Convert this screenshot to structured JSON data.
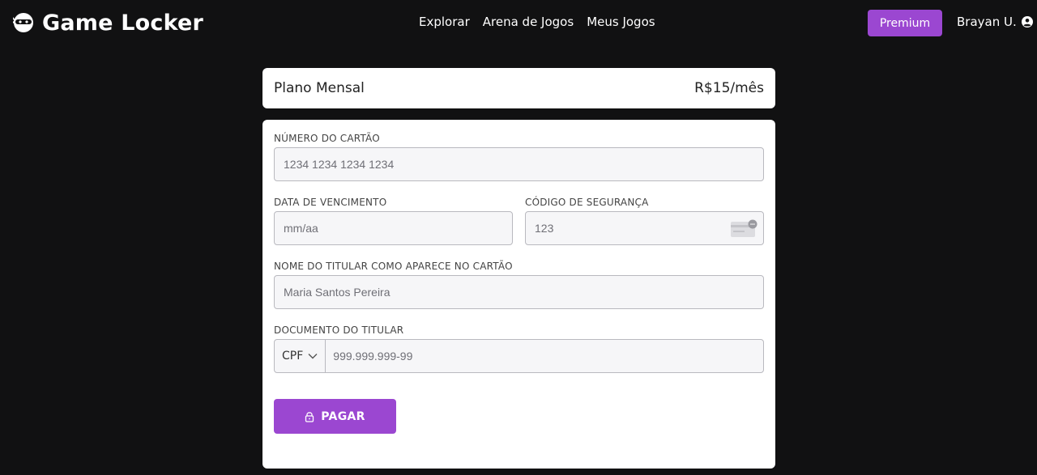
{
  "header": {
    "brand": "Game Locker",
    "nav": [
      "Explorar",
      "Arena de Jogos",
      "Meus Jogos"
    ],
    "premium_label": "Premium",
    "user_name": "Brayan U."
  },
  "plan": {
    "name": "Plano Mensal",
    "price": "R$15/mês"
  },
  "form": {
    "card_number": {
      "label": "NÚMERO DO CARTÃO",
      "placeholder": "1234 1234 1234 1234",
      "value": ""
    },
    "expiry": {
      "label": "DATA DE VENCIMENTO",
      "placeholder": "mm/aa",
      "value": ""
    },
    "cvv": {
      "label": "CÓDIGO DE SEGURANÇA",
      "placeholder": "123",
      "value": ""
    },
    "holder_name": {
      "label": "NOME DO TITULAR COMO APARECE NO CARTÃO",
      "placeholder": "Maria Santos Pereira",
      "value": ""
    },
    "document": {
      "label": "DOCUMENTO DO TITULAR",
      "type_selected": "CPF",
      "placeholder": "999.999.999-99",
      "value": ""
    },
    "pay_label": "PAGAR"
  },
  "colors": {
    "background": "#111112",
    "accent": "#9b47d1",
    "card": "#ffffff",
    "field_bg": "#f6f6f8"
  },
  "icons": {
    "logo": "ninja-mask-icon",
    "user": "user-circle-icon",
    "cvv": "credit-card-icon",
    "pay": "lock-icon",
    "select": "chevron-down-icon"
  }
}
